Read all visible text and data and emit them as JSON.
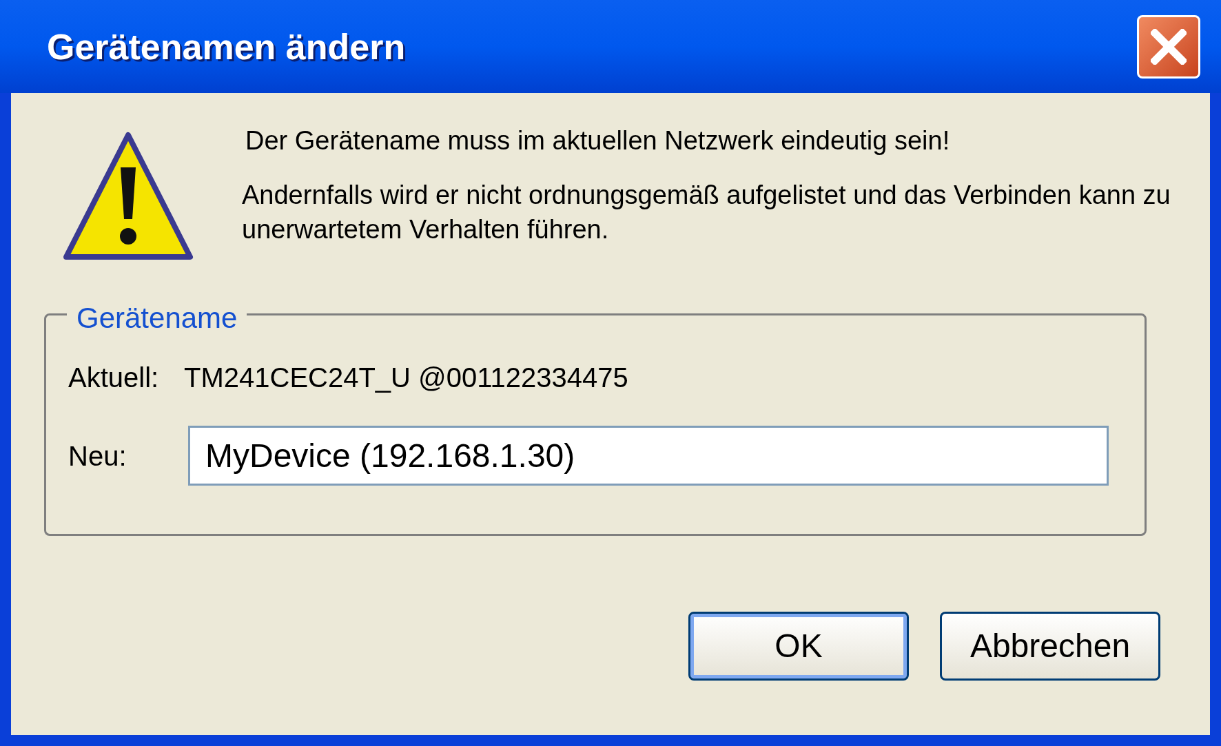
{
  "window": {
    "title": "Gerätenamen ändern"
  },
  "message": [
    "Der Gerätename muss im aktuellen Netzwerk eindeutig sein!",
    "Andernfalls wird er nicht ordnungsgemäß aufgelistet und das Verbinden kann zu unerwartetem Verhalten führen."
  ],
  "group": {
    "legend": "Gerätename",
    "current_label": "Aktuell:",
    "current_value": "TM241CEC24T_U @001122334475",
    "new_label": "Neu:",
    "new_value": "MyDevice (192.168.1.30)"
  },
  "buttons": [
    {
      "label": "OK",
      "default": true
    },
    {
      "label": "Abbrechen",
      "default": false
    }
  ]
}
